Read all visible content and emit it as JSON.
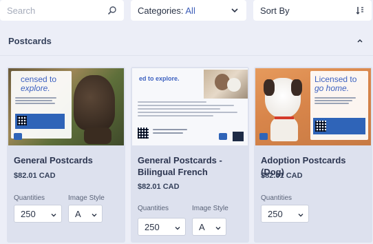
{
  "toolbar": {
    "search_placeholder": "Search",
    "categories_label": "Categories:",
    "categories_value": "All",
    "sort_label": "Sort By"
  },
  "section": {
    "title": "Postcards"
  },
  "cards": [
    {
      "title": "General Postcards",
      "price": "$82.01 CAD",
      "quantities_label": "Quantities",
      "quantity_value": "250",
      "image_style_label": "Image Style",
      "image_style_value": "A",
      "thumb": {
        "headline_1": "censed to",
        "headline_2": "explore."
      }
    },
    {
      "title": "General Postcards - Bilingual French",
      "price": "$82.01 CAD",
      "quantities_label": "Quantities",
      "quantity_value": "250",
      "image_style_label": "Image Style",
      "image_style_value": "A",
      "thumb": {
        "headline_1": "ed to explore."
      }
    },
    {
      "title": "Adoption Postcards (Dog)",
      "price": "$82.01 CAD",
      "quantities_label": "Quantities",
      "quantity_value": "250",
      "thumb": {
        "headline_1": "Licensed to",
        "headline_2": "go home."
      }
    }
  ],
  "colors": {
    "accent": "#3b5cb8",
    "page_bg": "#eceef7",
    "card_bg": "#dde1ee"
  },
  "icons": [
    "search-icon",
    "chevron-down-icon",
    "sort-icon",
    "chevron-up-icon"
  ]
}
